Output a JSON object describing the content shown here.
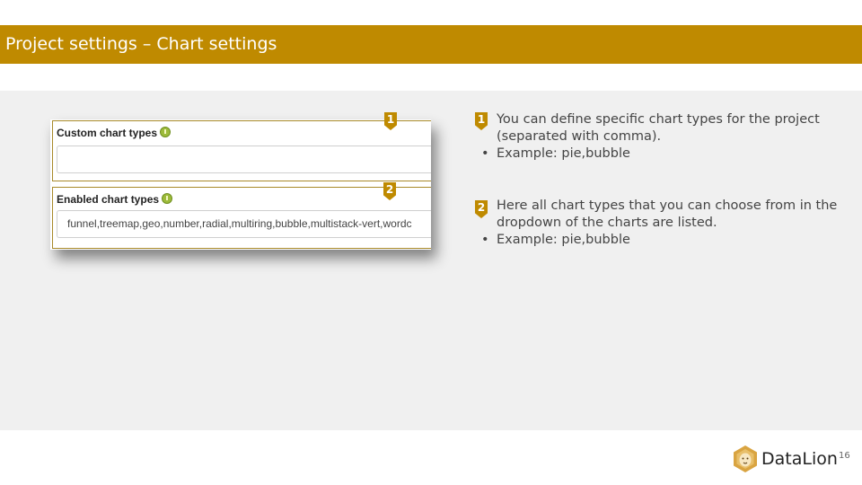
{
  "slide": {
    "title": "Project settings – Chart settings",
    "page_number": "16",
    "brand_name": "DataLion",
    "accent_color": "#bf8a00"
  },
  "screenshot": {
    "field1": {
      "marker": "1",
      "label": "Custom chart types",
      "value": ""
    },
    "field2": {
      "marker": "2",
      "label": "Enabled chart types",
      "value": "funnel,treemap,geo,number,radial,multiring,bubble,multistack-vert,wordc"
    }
  },
  "notes": [
    {
      "marker": "1",
      "text": "You can define specific chart types for the project (separated with comma).",
      "bullet": "Example: pie,bubble"
    },
    {
      "marker": "2",
      "text": "Here all chart types that you can choose from in the dropdown of the charts are listed.",
      "bullet": "Example: pie,bubble"
    }
  ],
  "icons": {
    "info": "info-icon",
    "logo": "lion-logo-icon"
  }
}
